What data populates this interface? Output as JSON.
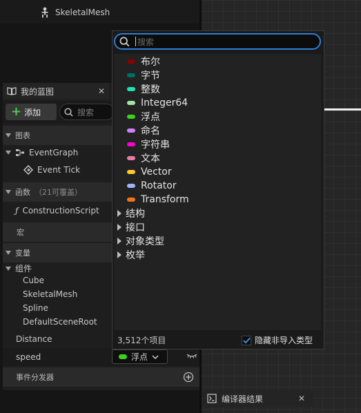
{
  "component_tree": {
    "skeletal_mesh_label": "SkeletalMesh"
  },
  "my_blueprint": {
    "tab_title": "我的蓝图",
    "add_label": "添加",
    "search_placeholder": "搜索",
    "sections": {
      "graphs": "图表",
      "functions": "函数",
      "functions_hint": "（21可覆盖）",
      "macros": "宏",
      "variables": "变量",
      "event_dispatchers": "事件分发器"
    },
    "event_graph": "EventGraph",
    "event_tick": "Event Tick",
    "construction_script": "ConstructionScript",
    "components_group": "组件",
    "components": [
      "Cube",
      "SkeletalMesh",
      "Spline",
      "DefaultSceneRoot"
    ],
    "variables": [
      {
        "name": "Distance"
      },
      {
        "name": "speed",
        "type_label": "浮点",
        "type_color": "#3ad31c"
      }
    ]
  },
  "type_picker": {
    "search_placeholder": "搜索",
    "types": [
      {
        "label": "布尔",
        "color": "#8c0000"
      },
      {
        "label": "字节",
        "color": "#006f65"
      },
      {
        "label": "整数",
        "color": "#1fe3af"
      },
      {
        "label": "Integer64",
        "color": "#a3e3a3"
      },
      {
        "label": "浮点",
        "color": "#3ad31c"
      },
      {
        "label": "命名",
        "color": "#cd82fa"
      },
      {
        "label": "字符串",
        "color": "#fb00d1"
      },
      {
        "label": "文本",
        "color": "#e57ca4"
      },
      {
        "label": "Vector",
        "color": "#fdc82a"
      },
      {
        "label": "Rotator",
        "color": "#9fb2fb"
      },
      {
        "label": "Transform",
        "color": "#f27415"
      }
    ],
    "categories": [
      "结构",
      "接口",
      "对象类型",
      "枚举"
    ],
    "item_count": "3,512个项目",
    "hide_unloaded_label": "隐藏非导入类型",
    "hide_unloaded_checked": true
  },
  "compiler_results_tab": "编译器结果",
  "colors": {
    "accent": "#2e7fd6",
    "wire": "#f0f0f0"
  }
}
